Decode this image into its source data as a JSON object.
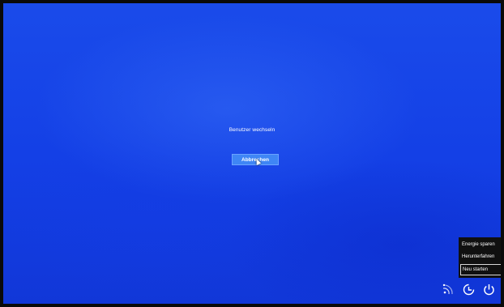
{
  "dialog": {
    "title": "Benutzer wechseln",
    "cancel_label": "Abbrechen"
  },
  "power_menu": {
    "items": [
      {
        "label": "Energie sparen",
        "selected": false
      },
      {
        "label": "Herunterfahren",
        "selected": false
      },
      {
        "label": "Neu starten",
        "selected": true
      }
    ]
  },
  "tray_icons": [
    "network-icon",
    "ease-of-access-icon",
    "power-icon"
  ],
  "colors": {
    "background": "#1440e6",
    "button": "#3f86f5",
    "menu_background": "#101010",
    "text": "#ffffff"
  }
}
